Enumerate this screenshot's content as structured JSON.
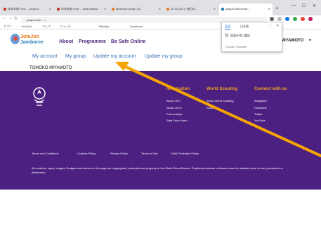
{
  "browser": {
    "tabs": [
      {
        "label": "年末年始 Free… Gudrun…",
        "color": "#c0392b"
      },
      {
        "label": "年末年始 Free… Sadi Hadrat…",
        "color": "#c0392b"
      },
      {
        "label": "jamboree.world | ゆ…",
        "color": "#e67e22"
      },
      {
        "label": "JOTA-JOTI | 毎日の…",
        "color": "#e67e22"
      },
      {
        "label": "jotajoti.info/mema…",
        "color": "#2980b9",
        "active": true
      }
    ],
    "new_tab": "+",
    "url": "jotajoti.info/…/…",
    "bookmarks": [
      "アプリ",
      "YouTube",
      "マップ",
      "ニュース",
      "Officially…",
      "Download…"
    ]
  },
  "site": {
    "logo_line1": "JotaJoti",
    "logo_line2": "Jamboree",
    "nav": [
      "About",
      "Programme",
      "Be Safe Online"
    ],
    "username": "TOMOKO MIYAMOTO",
    "username_short": "MIYAMOTO",
    "caret": "▾",
    "subnav": [
      "My account",
      "My group",
      "Update my account",
      "Update my group"
    ]
  },
  "footer": {
    "columns": [
      {
        "heading": "Information",
        "links": [
          "About JOTI",
          "About JOTA",
          "Partnerships",
          "Safe From Harm"
        ]
      },
      {
        "heading": "World Scouting",
        "links": [
          "About World Scouting",
          "Scout.org"
        ]
      },
      {
        "heading": "Connect with us",
        "links": [
          "Instagram",
          "Facebook",
          "Twitter",
          "YouTube"
        ]
      }
    ],
    "legal_links": [
      "Terms and Conditions",
      "Cookies Policy",
      "Privacy Policy",
      "Terms of Use",
      "Child Protection Policy"
    ],
    "copyright": "All contents, logos, images, Badges and videos on this page are copyrighted, protected and property of the World Scout Bureau. Explicit permission or license must be obtained prior to use, production or distribution."
  },
  "translate_popup": {
    "tab1": "英語",
    "tab2": "日本語",
    "option": "英語を常に翻訳",
    "brand": "Google Translate"
  },
  "colors": {
    "footer_bg": "#4b2080",
    "accent_orange": "#f0a020",
    "link_blue": "#3a6db5"
  }
}
